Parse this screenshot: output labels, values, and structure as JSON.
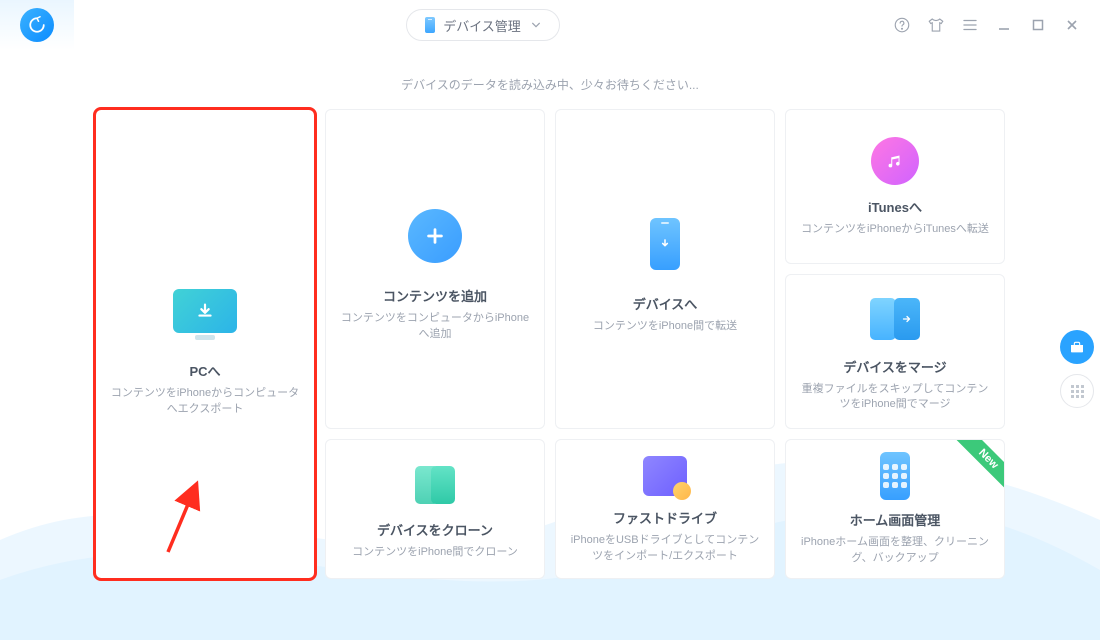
{
  "header": {
    "device_button_label": "デバイス管理"
  },
  "loading_text": "デバイスのデータを読み込み中、少々お待ちください...",
  "tiles": {
    "pc": {
      "title": "PCへ",
      "desc": "コンテンツをiPhoneからコンピュータへエクスポート"
    },
    "add": {
      "title": "コンテンツを追加",
      "desc": "コンテンツをコンピュータからiPhoneへ追加"
    },
    "device": {
      "title": "デバイスへ",
      "desc": "コンテンツをiPhone間で転送"
    },
    "itunes": {
      "title": "iTunesへ",
      "desc": "コンテンツをiPhoneからiTunesへ転送"
    },
    "merge": {
      "title": "デバイスをマージ",
      "desc": "重複ファイルをスキップしてコンテンツをiPhone間でマージ"
    },
    "clone": {
      "title": "デバイスをクローン",
      "desc": "コンテンツをiPhone間でクローン"
    },
    "fastdrive": {
      "title": "ファストドライブ",
      "desc": "iPhoneをUSBドライブとしてコンテンツをインポート/エクスポート"
    },
    "home": {
      "title": "ホーム画面管理",
      "desc": "iPhoneホーム画面を整理、クリーニング、バックアップ",
      "badge": "New"
    }
  }
}
